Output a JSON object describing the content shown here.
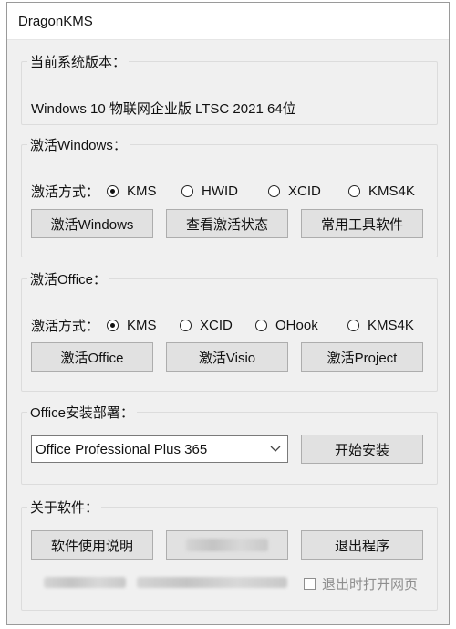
{
  "window": {
    "title": "DragonKMS"
  },
  "version_group": {
    "legend": "当前系统版本：",
    "value": "Windows 10 物联网企业版 LTSC 2021 64位"
  },
  "windows_group": {
    "legend": "激活Windows：",
    "method_label": "激活方式：",
    "options": [
      "KMS",
      "HWID",
      "XCID",
      "KMS4K"
    ],
    "selected": "KMS",
    "buttons": [
      "激活Windows",
      "查看激活状态",
      "常用工具软件"
    ]
  },
  "office_group": {
    "legend": "激活Office：",
    "method_label": "激活方式：",
    "options": [
      "KMS",
      "XCID",
      "OHook",
      "KMS4K"
    ],
    "selected": "KMS",
    "buttons": [
      "激活Office",
      "激活Visio",
      "激活Project"
    ]
  },
  "install_group": {
    "legend": "Office安装部署：",
    "selected_product": "Office Professional Plus 365",
    "install_button": "开始安装"
  },
  "about_group": {
    "legend": "关于软件：",
    "manual_button": "软件使用说明",
    "exit_button": "退出程序",
    "open_web_checkbox": "退出时打开网页",
    "open_web_checked": false
  },
  "icons": {
    "dropdown": "chevron-down-icon"
  }
}
